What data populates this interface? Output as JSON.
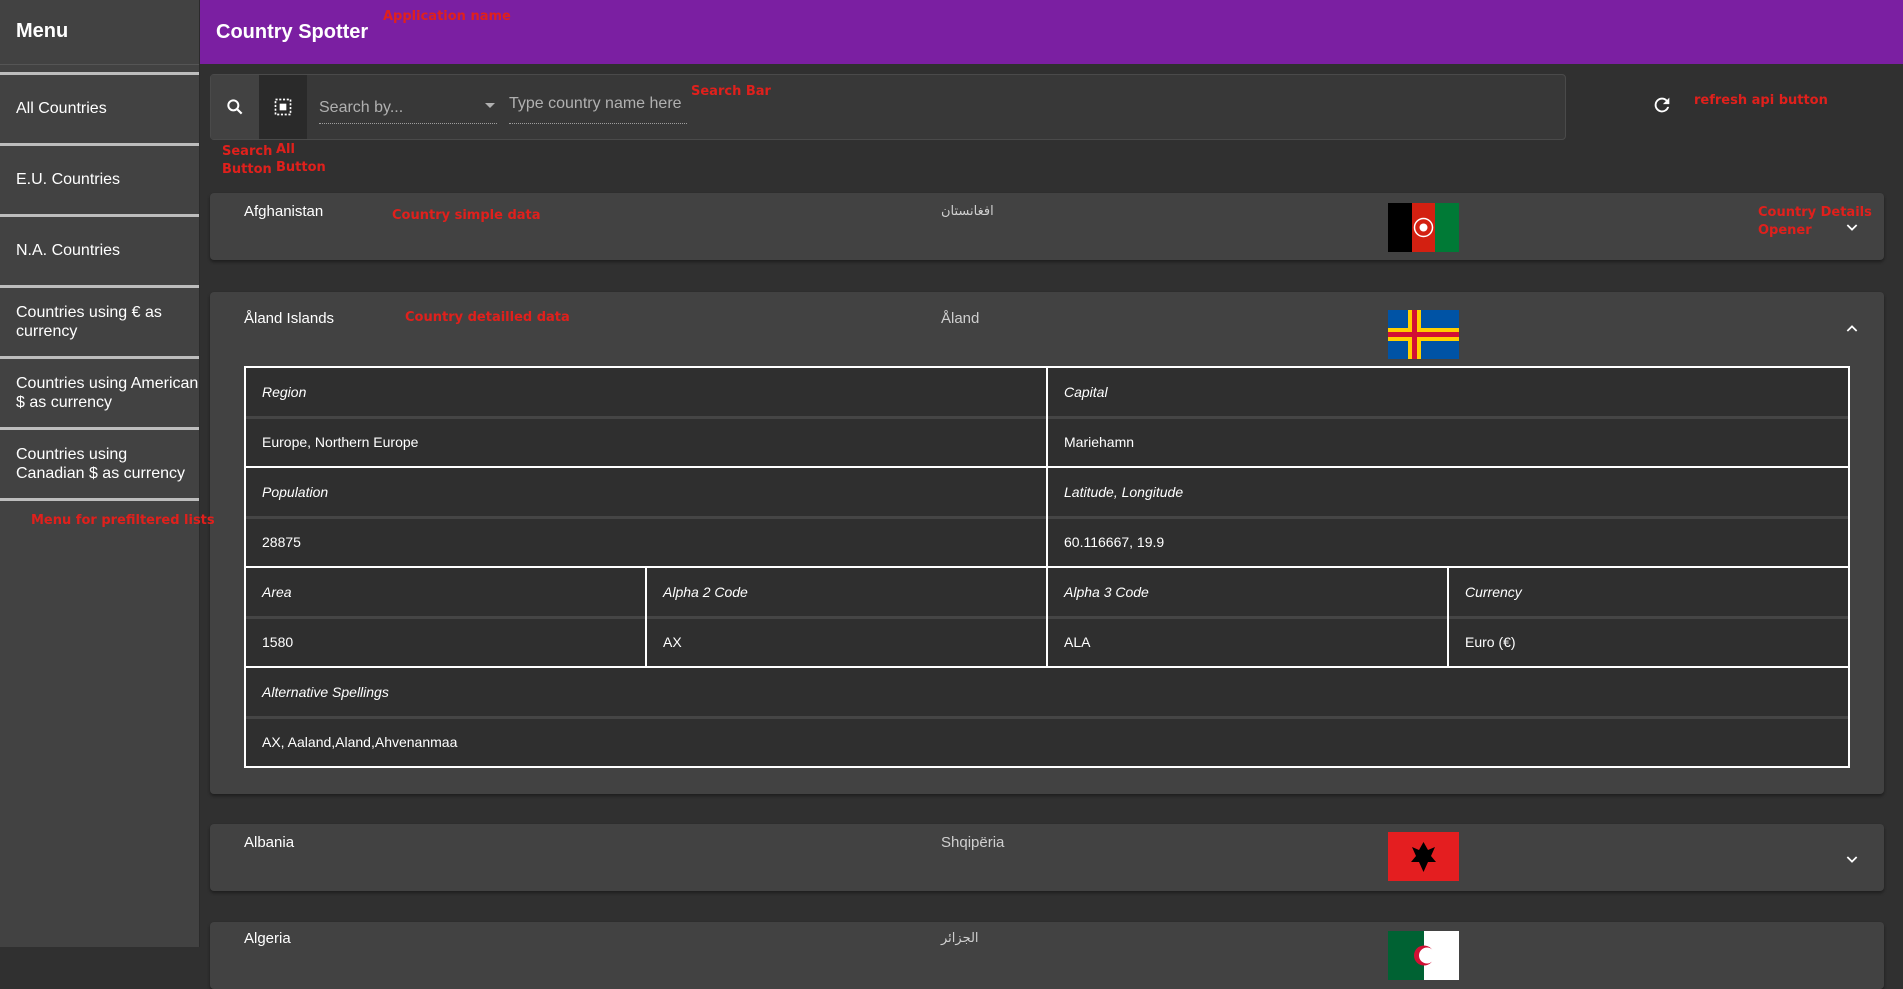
{
  "app": {
    "title": "Country Spotter"
  },
  "sidebar": {
    "title": "Menu",
    "items": [
      {
        "label": "All Countries"
      },
      {
        "label": "E.U. Countries"
      },
      {
        "label": "N.A. Countries"
      },
      {
        "label": "Countries using € as currency"
      },
      {
        "label": "Countries using American $ as currency"
      },
      {
        "label": "Countries using Canadian $ as currency"
      }
    ]
  },
  "search": {
    "search_by_placeholder": "Search by...",
    "country_placeholder": "Type country name here",
    "search_icon": "search-icon",
    "all_icon": "select-all-icon",
    "refresh_icon": "refresh-icon"
  },
  "countries": [
    {
      "name": "Afghanistan",
      "native": "افغانستان",
      "expanded": false
    },
    {
      "name": "Åland Islands",
      "native": "Åland",
      "expanded": true
    },
    {
      "name": "Albania",
      "native": "Shqipëria",
      "expanded": false
    },
    {
      "name": "Algeria",
      "native": "الجزائر",
      "expanded": false
    }
  ],
  "details": {
    "region_label": "Region",
    "region": "Europe, Northern Europe",
    "capital_label": "Capital",
    "capital": "Mariehamn",
    "population_label": "Population",
    "population": "28875",
    "latlng_label": "Latitude, Longitude",
    "latlng": "60.116667, 19.9",
    "area_label": "Area",
    "area": "1580",
    "alpha2_label": "Alpha 2 Code",
    "alpha2": "AX",
    "alpha3_label": "Alpha 3 Code",
    "alpha3": "ALA",
    "currency_label": "Currency",
    "currency": "Euro (€)",
    "altspell_label": "Alternative Spellings",
    "altspell": "AX, Aaland,Aland,Ahvenanmaa"
  },
  "annotations": {
    "app_name": "Application name",
    "search_bar": "Search Bar",
    "refresh": "refresh api button",
    "search_button": "Search\nButton",
    "all_button": "All\nButton",
    "simple_data": "Country simple data",
    "details_opener": "Country Details\nOpener",
    "detailled_data": "Country detailled data",
    "menu": "Menu for prefiltered lists"
  },
  "colors": {
    "header": "#7b1fa2",
    "background": "#303030",
    "panel": "#424242",
    "annotation": "#e0201c"
  }
}
